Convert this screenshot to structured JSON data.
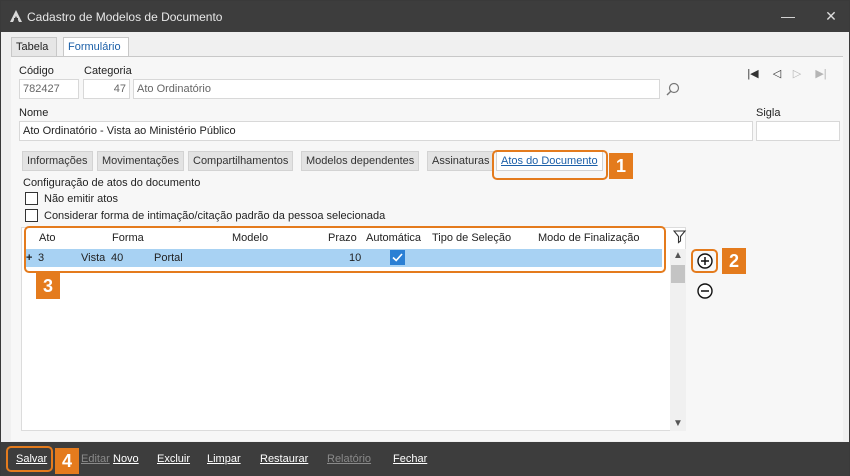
{
  "window": {
    "title": "Cadastro de Modelos de Documento"
  },
  "tabs": {
    "tabela": "Tabela",
    "formulario": "Formulário"
  },
  "form": {
    "codigo_label": "Código",
    "codigo_value": "782427",
    "categoria_label": "Categoria",
    "categoria_num": "47",
    "categoria_name": "Ato Ordinatório",
    "nome_label": "Nome",
    "nome_value": "Ato Ordinatório - Vista ao Ministério Público",
    "sigla_label": "Sigla",
    "sigla_value": ""
  },
  "subtabs": [
    "Informações",
    "Movimentações",
    "Compartilhamentos",
    "Modelos dependentes",
    "Assinaturas",
    "Atos do Documento"
  ],
  "section": {
    "title": "Configuração de atos do documento",
    "opt1": "Não emitir atos",
    "opt2": "Considerar forma de intimação/citação padrão da pessoa selecionada"
  },
  "grid": {
    "columns": [
      "Ato",
      "Forma",
      "Modelo",
      "Prazo",
      "Automática",
      "Tipo de Seleção",
      "Modo de Finalização"
    ],
    "rows": [
      {
        "ato": "3",
        "vista": "Vista",
        "forma": "40",
        "modelo": "Portal",
        "prazo": "10",
        "automatica": true
      }
    ]
  },
  "callouts": [
    "1",
    "2",
    "3",
    "4"
  ],
  "footer": {
    "salvar": "Salvar",
    "editar": "Editar",
    "novo": "Novo",
    "excluir": "Excluir",
    "limpar": "Limpar",
    "restaurar": "Restaurar",
    "relatorio": "Relatório",
    "fechar": "Fechar"
  }
}
